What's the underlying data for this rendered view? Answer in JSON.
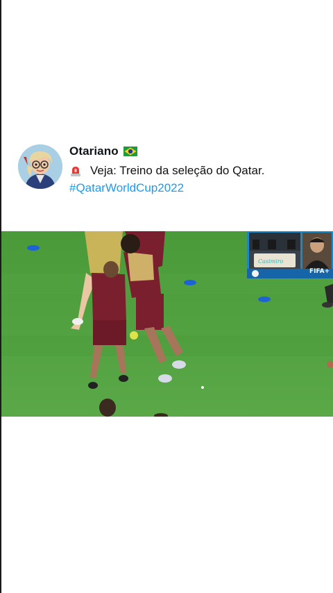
{
  "tweet": {
    "display_name": "Otariano",
    "text": "Veja: Treino da seleção do Qatar.",
    "hashtag": "#QatarWorldCup2022"
  },
  "icons": {
    "flag": "brazil-flag-icon",
    "alert": "red-siren-icon",
    "avatar": "cartoon-avatar"
  },
  "video": {
    "overlay_badge": "FIFA+",
    "overlay_logo": "Casimiro"
  },
  "colors": {
    "hashtag": "#1d9bf0",
    "pitch": "#4f9a3f",
    "jersey": "#7a1f2e"
  }
}
